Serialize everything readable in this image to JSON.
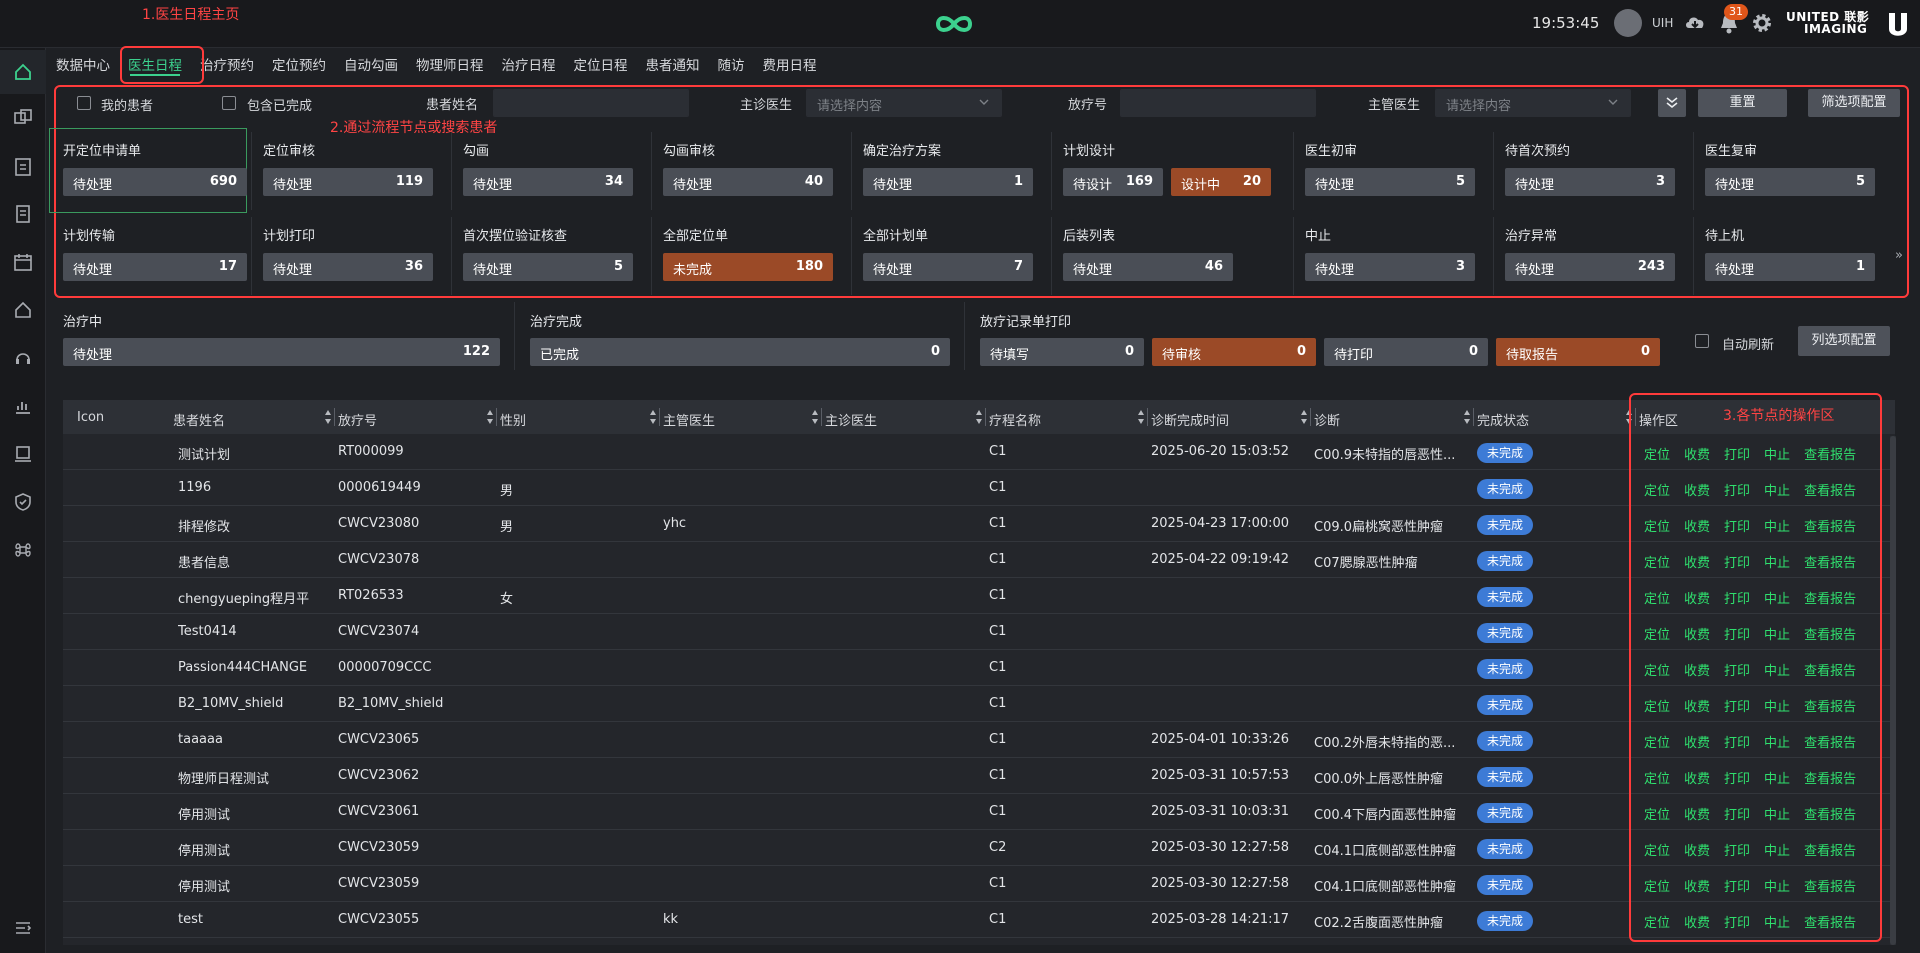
{
  "annotations": {
    "a1": "1.医生日程主页",
    "a2": "2.通过流程节点或搜索患者",
    "a3": "3.各节点的操作区"
  },
  "header": {
    "clock": "19:53:45",
    "user": "UIH",
    "notification_count": "31",
    "brand_line1": "UNITED 联影",
    "brand_line2": "IMAGING"
  },
  "tabs": [
    {
      "label": "数据中心"
    },
    {
      "label": "医生日程"
    },
    {
      "label": "治疗预约"
    },
    {
      "label": "定位预约"
    },
    {
      "label": "自动勾画"
    },
    {
      "label": "物理师日程"
    },
    {
      "label": "治疗日程"
    },
    {
      "label": "定位日程"
    },
    {
      "label": "患者通知"
    },
    {
      "label": "随访"
    },
    {
      "label": "费用日程"
    }
  ],
  "filters": {
    "my_patients": "我的患者",
    "include_done": "包含已完成",
    "patient_name": "患者姓名",
    "attending": "主诊医生",
    "attending_placeholder": "请选择内容",
    "rt_no": "放疗号",
    "managing": "主管医生",
    "managing_placeholder": "请选择内容",
    "reset": "重置",
    "filter_config": "筛选项配置"
  },
  "stages_row1": [
    {
      "title": "开定位申请单",
      "pills": [
        {
          "label": "待处理",
          "count": "690"
        }
      ]
    },
    {
      "title": "定位审核",
      "pills": [
        {
          "label": "待处理",
          "count": "119"
        }
      ]
    },
    {
      "title": "勾画",
      "pills": [
        {
          "label": "待处理",
          "count": "34"
        }
      ]
    },
    {
      "title": "勾画审核",
      "pills": [
        {
          "label": "待处理",
          "count": "40"
        }
      ]
    },
    {
      "title": "确定治疗方案",
      "pills": [
        {
          "label": "待处理",
          "count": "1"
        }
      ]
    },
    {
      "title": "计划设计",
      "pills": [
        {
          "label": "待设计",
          "count": "169"
        },
        {
          "label": "设计中",
          "count": "20"
        }
      ]
    },
    {
      "title": "医生初审",
      "pills": [
        {
          "label": "待处理",
          "count": "5"
        }
      ]
    },
    {
      "title": "待首次预约",
      "pills": [
        {
          "label": "待处理",
          "count": "3"
        }
      ]
    },
    {
      "title": "医生复审",
      "pills": [
        {
          "label": "待处理",
          "count": "5"
        }
      ]
    }
  ],
  "stages_row2": [
    {
      "title": "计划传输",
      "pills": [
        {
          "label": "待处理",
          "count": "17"
        }
      ]
    },
    {
      "title": "计划打印",
      "pills": [
        {
          "label": "待处理",
          "count": "36"
        }
      ]
    },
    {
      "title": "首次摆位验证核查",
      "pills": [
        {
          "label": "待处理",
          "count": "5"
        }
      ]
    },
    {
      "title": "全部定位单",
      "pills": [
        {
          "label": "未完成",
          "count": "180"
        }
      ]
    },
    {
      "title": "全部计划单",
      "pills": [
        {
          "label": "待处理",
          "count": "7"
        }
      ]
    },
    {
      "title": "后装列表",
      "pills": [
        {
          "label": "待处理",
          "count": "46"
        }
      ]
    },
    {
      "title": "中止",
      "pills": [
        {
          "label": "待处理",
          "count": "3"
        }
      ]
    },
    {
      "title": "治疗异常",
      "pills": [
        {
          "label": "待处理",
          "count": "243"
        }
      ]
    },
    {
      "title": "待上机",
      "pills": [
        {
          "label": "待处理",
          "count": "1"
        }
      ]
    }
  ],
  "stages_row3": [
    {
      "title": "治疗中",
      "pills": [
        {
          "label": "待处理",
          "count": "122"
        }
      ]
    },
    {
      "title": "治疗完成",
      "pills": [
        {
          "label": "已完成",
          "count": "0"
        }
      ]
    },
    {
      "title": "放疗记录单打印",
      "pills": [
        {
          "label": "待填写",
          "count": "0"
        },
        {
          "label": "待审核",
          "count": "0"
        },
        {
          "label": "待打印",
          "count": "0"
        },
        {
          "label": "待取报告",
          "count": "0"
        }
      ]
    }
  ],
  "auto_refresh": "自动刷新",
  "column_config": "列选项配置",
  "table": {
    "columns": [
      "Icon",
      "患者姓名",
      "放疗号",
      "性别",
      "主管医生",
      "主诊医生",
      "疗程名称",
      "诊断完成时间",
      "诊断",
      "完成状态",
      "操作区"
    ],
    "ops": [
      "定位",
      "收费",
      "打印",
      "中止",
      "查看报告"
    ],
    "rows": [
      {
        "name": "测试计划",
        "rt": "RT000099",
        "sex": "",
        "managing": "",
        "attending": "",
        "course": "C1",
        "time": "2025-06-20 15:03:52",
        "diag": "C00.9未特指的唇恶性...",
        "status": "未完成"
      },
      {
        "name": "1196",
        "rt": "0000619449",
        "sex": "男",
        "managing": "",
        "attending": "",
        "course": "C1",
        "time": "",
        "diag": "",
        "status": "未完成"
      },
      {
        "name": "排程修改",
        "rt": "CWCV23080",
        "sex": "男",
        "managing": "yhc",
        "attending": "",
        "course": "C1",
        "time": "2025-04-23 17:00:00",
        "diag": "C09.0扁桃窝恶性肿瘤",
        "status": "未完成"
      },
      {
        "name": "患者信息",
        "rt": "CWCV23078",
        "sex": "",
        "managing": "",
        "attending": "",
        "course": "C1",
        "time": "2025-04-22 09:19:42",
        "diag": "C07腮腺恶性肿瘤",
        "status": "未完成"
      },
      {
        "name": "chengyueping程月平",
        "rt": "RT026533",
        "sex": "女",
        "managing": "",
        "attending": "",
        "course": "C1",
        "time": "",
        "diag": "",
        "status": "未完成"
      },
      {
        "name": "Test0414",
        "rt": "CWCV23074",
        "sex": "",
        "managing": "",
        "attending": "",
        "course": "C1",
        "time": "",
        "diag": "",
        "status": "未完成"
      },
      {
        "name": "Passion444CHANGE",
        "rt": "00000709CCC",
        "sex": "",
        "managing": "",
        "attending": "",
        "course": "C1",
        "time": "",
        "diag": "",
        "status": "未完成"
      },
      {
        "name": "B2_10MV_shield",
        "rt": "B2_10MV_shield",
        "sex": "",
        "managing": "",
        "attending": "",
        "course": "C1",
        "time": "",
        "diag": "",
        "status": "未完成"
      },
      {
        "name": "taaaaa",
        "rt": "CWCV23065",
        "sex": "",
        "managing": "",
        "attending": "",
        "course": "C1",
        "time": "2025-04-01 10:33:26",
        "diag": "C00.2外唇未特指的恶...",
        "status": "未完成"
      },
      {
        "name": "物理师日程测试",
        "rt": "CWCV23062",
        "sex": "",
        "managing": "",
        "attending": "",
        "course": "C1",
        "time": "2025-03-31 10:57:53",
        "diag": "C00.0外上唇恶性肿瘤",
        "status": "未完成"
      },
      {
        "name": "停用测试",
        "rt": "CWCV23061",
        "sex": "",
        "managing": "",
        "attending": "",
        "course": "C1",
        "time": "2025-03-31 10:03:31",
        "diag": "C00.4下唇内面恶性肿瘤",
        "status": "未完成"
      },
      {
        "name": "停用测试",
        "rt": "CWCV23059",
        "sex": "",
        "managing": "",
        "attending": "",
        "course": "C2",
        "time": "2025-03-30 12:27:58",
        "diag": "C04.1口底侧部恶性肿瘤",
        "status": "未完成"
      },
      {
        "name": "停用测试",
        "rt": "CWCV23059",
        "sex": "",
        "managing": "",
        "attending": "",
        "course": "C1",
        "time": "2025-03-30 12:27:58",
        "diag": "C04.1口底侧部恶性肿瘤",
        "status": "未完成"
      },
      {
        "name": "test",
        "rt": "CWCV23055",
        "sex": "",
        "managing": "kk",
        "attending": "",
        "course": "C1",
        "time": "2025-03-28 14:21:17",
        "diag": "C02.2舌腹面恶性肿瘤",
        "status": "未完成"
      }
    ]
  },
  "colors": {
    "accent": "#3cd18e",
    "annotation": "#ff3b3b",
    "op_green": "#2fe06e",
    "status_blue": "#3d7bd6",
    "orange": "#9b4a27"
  }
}
